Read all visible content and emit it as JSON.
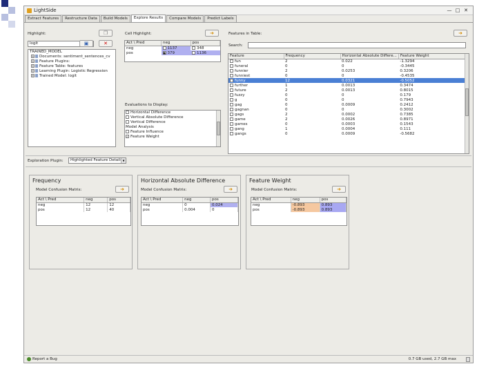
{
  "app": {
    "title": "LightSide",
    "min": "—",
    "max": "□",
    "close": "✕"
  },
  "tabs": [
    "Extract Features",
    "Restructure Data",
    "Build Models",
    "Explore Results",
    "Compare Models",
    "Predict Labels"
  ],
  "highlight": {
    "label": "Highlight:",
    "selected": "logit",
    "tree_header": "TRAINED_MODEL",
    "tree_items": [
      "Documents: sentiment_sentences_cv",
      "Feature Plugins:",
      "Feature Table: features",
      "Learning Plugin: Logistic Regression",
      "Trained Model: logit"
    ]
  },
  "cell_highlight": {
    "label": "Cell Highlight:",
    "headers": [
      "Act \\ Pred",
      "neg",
      "pos"
    ],
    "rows": [
      [
        "neg",
        "1137",
        "348"
      ],
      [
        "pos",
        "379",
        "1136"
      ]
    ]
  },
  "evaluations": {
    "label": "Evaluations to Display:",
    "items": [
      {
        "text": "Horizontal Difference",
        "checked": false
      },
      {
        "text": "Vertical Absolute Difference",
        "checked": false
      },
      {
        "text": "Vertical Difference",
        "checked": false
      },
      {
        "text": "Model Analysis",
        "checked": null
      },
      {
        "text": "Feature Influence",
        "checked": false
      },
      {
        "text": "Feature Weight",
        "checked": true
      }
    ]
  },
  "features": {
    "label": "Features in Table:",
    "search_label": "Search:",
    "search_value": "",
    "headers": [
      "Feature",
      "Frequency",
      "Horizontal Absolute Differe...",
      "Feature Weight"
    ],
    "rows": [
      [
        "fun",
        "2",
        "0.022",
        "-1.3294"
      ],
      [
        "funeral",
        "0",
        "0",
        "-0.3445"
      ],
      [
        "funnier",
        "2",
        "0.0253",
        "0.3206"
      ],
      [
        "funniest",
        "0",
        "0",
        "-0.4535"
      ],
      [
        "funny",
        "12",
        "0.0321",
        "-0.5052"
      ],
      [
        "further",
        "1",
        "0.0013",
        "0.3474"
      ],
      [
        "future",
        "2",
        "0.0013",
        "0.8015"
      ],
      [
        "fuzzy",
        "0",
        "0",
        "0.179"
      ],
      [
        "g",
        "0",
        "0",
        "0.7943"
      ],
      [
        "gag",
        "0",
        "0.0009",
        "0.2412"
      ],
      [
        "gagnan",
        "0",
        "0",
        "0.3002"
      ],
      [
        "gags",
        "2",
        "0.0002",
        "0.7385"
      ],
      [
        "game",
        "2",
        "0.0026",
        "0.8971"
      ],
      [
        "games",
        "0",
        "0.0003",
        "0.1543"
      ],
      [
        "gang",
        "1",
        "0.0004",
        "0.111"
      ],
      [
        "gangs",
        "0",
        "0.0009",
        "-0.5682"
      ]
    ],
    "selected_index": 4
  },
  "exploration": {
    "label": "Exploration Plugin:",
    "selected": "Highlighted Feature Details"
  },
  "panels": [
    {
      "title": "Frequency",
      "cm_label": "Model Confusion Matrix:",
      "headers": [
        "Act \\ Pred",
        "neg",
        "pos"
      ],
      "rows": [
        [
          "neg",
          "12",
          "12"
        ],
        [
          "pos",
          "12",
          "40"
        ]
      ]
    },
    {
      "title": "Horizontal Absolute Difference",
      "cm_label": "Model Confusion Matrix:",
      "headers": [
        "Act \\ Pred",
        "neg",
        "pos"
      ],
      "rows": [
        [
          "neg",
          "0",
          "0.024"
        ],
        [
          "pos",
          "0.004",
          "0"
        ]
      ]
    },
    {
      "title": "Feature Weight",
      "cm_label": "Model Confusion Matrix:",
      "headers": [
        "Act \\ Pred",
        "neg",
        "pos"
      ],
      "rows": [
        [
          "neg",
          "-0.893",
          "0.893"
        ],
        [
          "pos",
          "-0.893",
          "0.893"
        ]
      ]
    }
  ],
  "status": {
    "report": "Report a Bug",
    "memory": "0.7 GB used, 2.7 GB max"
  },
  "colors": {
    "selection": "#4a7fd4",
    "highlight_blue": "#b0b0f0",
    "highlight_orange": "#f5c8a0",
    "accent_dark": "#1e2b7a"
  }
}
